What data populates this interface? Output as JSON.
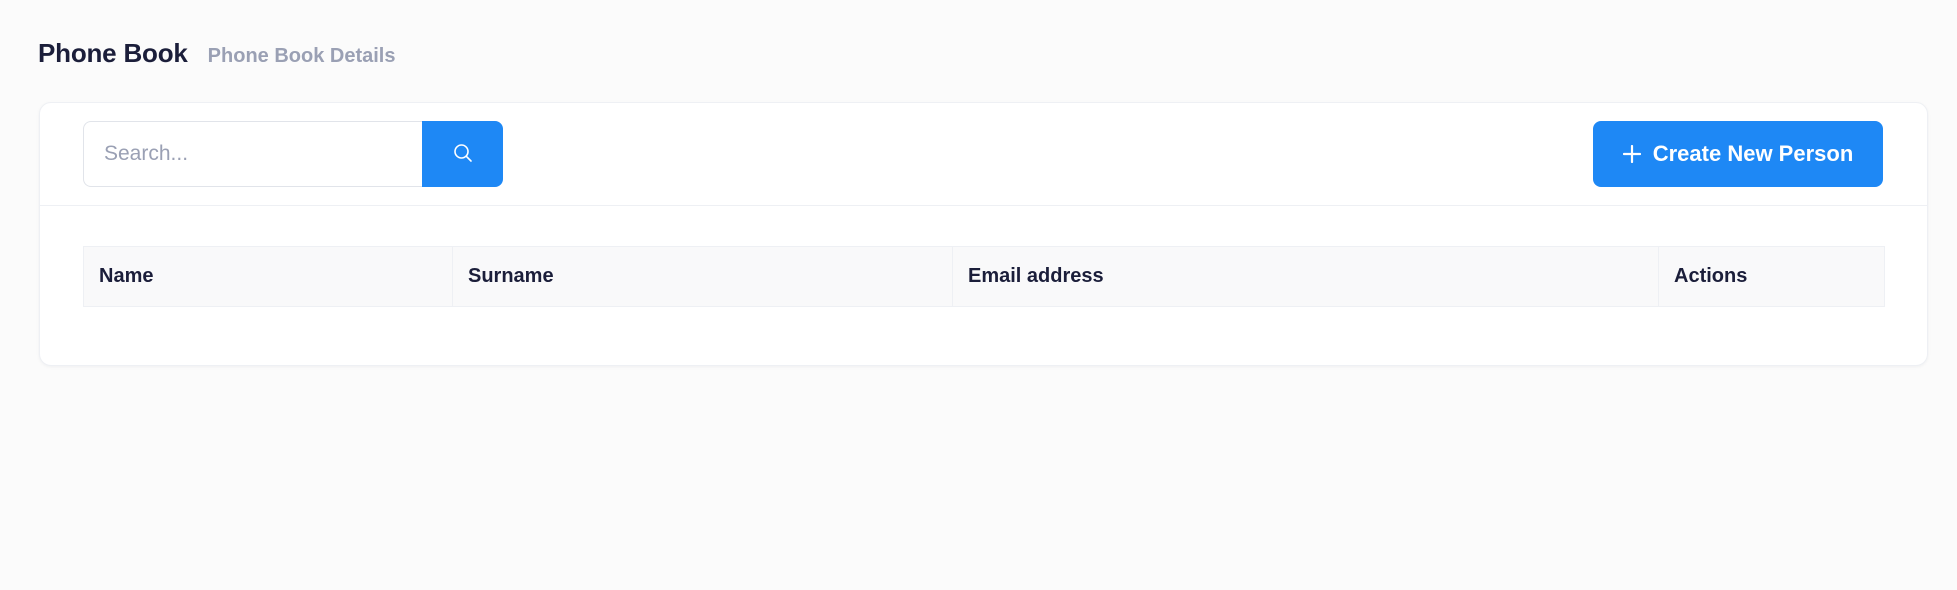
{
  "header": {
    "title": "Phone Book",
    "subtitle": "Phone Book Details"
  },
  "search": {
    "value": "",
    "placeholder": "Search...",
    "button_icon": "search-icon"
  },
  "toolbar": {
    "create_label": "Create New Person",
    "create_icon": "plus-icon"
  },
  "table": {
    "columns": [
      "Name",
      "Surname",
      "Email address",
      "Actions"
    ],
    "rows": []
  },
  "colors": {
    "accent": "#1e88f5",
    "title_text": "#1b1e3a",
    "muted_text": "#9aa0b4",
    "background": "#fbfbfb"
  }
}
